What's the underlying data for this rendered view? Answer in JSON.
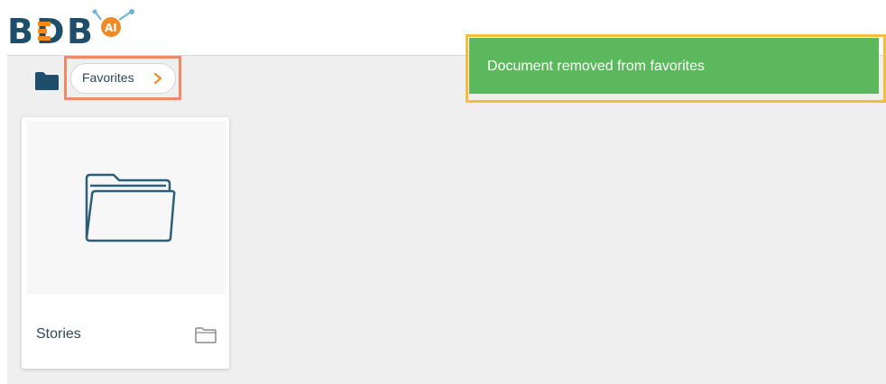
{
  "header": {
    "logo_text": "BDB",
    "logo_badge": "AI"
  },
  "breadcrumb": {
    "items": [
      {
        "label": "Favorites"
      }
    ]
  },
  "toast": {
    "message": "Document removed from favorites"
  },
  "folders": [
    {
      "name": "Stories"
    }
  ],
  "colors": {
    "brand_dark": "#1f4e6b",
    "brand_orange": "#f08a24",
    "toast_green": "#5cb85c",
    "breadcrumb_highlight": "#f08a65",
    "toast_highlight": "#f4bd3b"
  },
  "icons": {
    "root": "folder-icon",
    "breadcrumb_separator": "chevron-right-icon",
    "card_preview": "folder-open-icon",
    "card_type": "folder-outline-icon"
  }
}
